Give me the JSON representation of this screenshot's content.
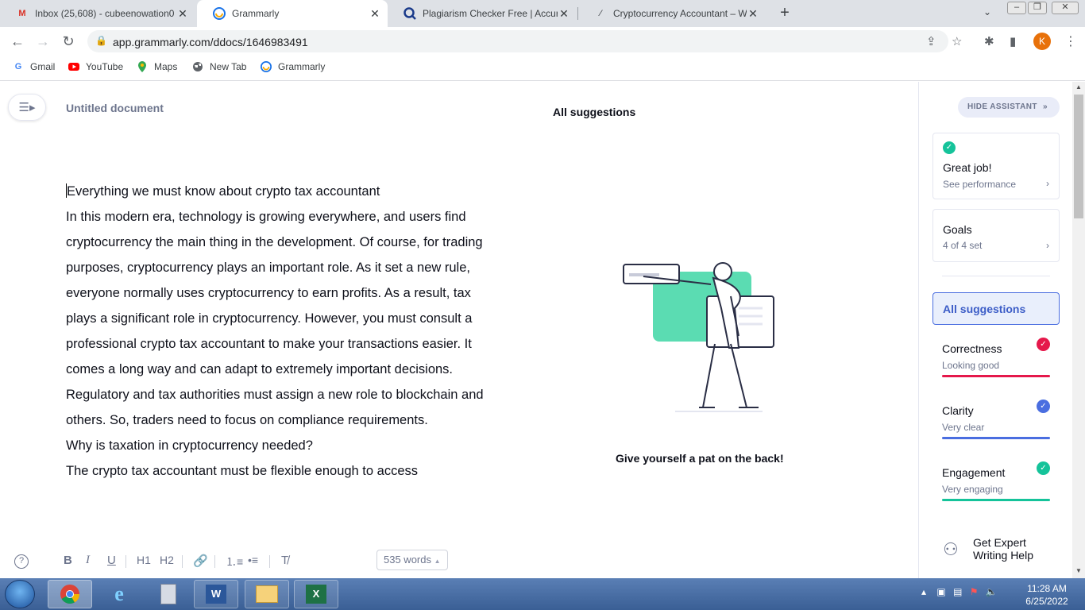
{
  "browser": {
    "tabs": [
      {
        "title": "Inbox (25,608) - cubeenowation0",
        "icon": "gmail-icon"
      },
      {
        "title": "Grammarly",
        "icon": "grammarly-icon",
        "active": true
      },
      {
        "title": "Plagiarism Checker Free | Accurat",
        "icon": "plagiarism-icon"
      },
      {
        "title": "Cryptocurrency Accountant – Wh",
        "icon": "docs-icon"
      }
    ],
    "new_tab": "+",
    "url": "app.grammarly.com/ddocs/1646983491",
    "profile_initial": "K",
    "bookmarks": [
      {
        "label": "Gmail",
        "icon": "google-icon"
      },
      {
        "label": "YouTube",
        "icon": "youtube-icon"
      },
      {
        "label": "Maps",
        "icon": "maps-icon"
      },
      {
        "label": "New Tab",
        "icon": "globe-icon"
      },
      {
        "label": "Grammarly",
        "icon": "grammarly-icon"
      }
    ]
  },
  "editor": {
    "doc_title": "Untitled document",
    "center_heading": "All suggestions",
    "illustration_caption": "Give yourself a pat on the back!",
    "paragraphs": [
      "Everything we must know about crypto tax accountant",
      "In this modern era, technology is growing everywhere, and users find cryptocurrency the main thing in the development. Of course, for trading purposes, cryptocurrency plays an important role. As it set a new rule, everyone normally uses cryptocurrency to earn profits. As a result, tax plays a significant role in cryptocurrency. However, you must consult a professional crypto tax accountant to make your transactions easier. It comes a long way and can adapt to extremely important decisions. Regulatory and tax authorities must assign a new role to blockchain and others. So, traders need to focus on compliance requirements.",
      "Why is taxation in cryptocurrency needed?",
      "The crypto tax accountant must be flexible enough to access"
    ],
    "toolbar": {
      "bold": "B",
      "italic": "I",
      "underline": "U",
      "h1": "H1",
      "h2": "H2",
      "word_count": "535 words"
    }
  },
  "assistant": {
    "hide_label": "HIDE ASSISTANT",
    "performance": {
      "title": "Great job!",
      "sub": "See performance"
    },
    "goals": {
      "title": "Goals",
      "sub": "4 of 4 set"
    },
    "all_suggestions": "All suggestions",
    "categories": [
      {
        "name": "Correctness",
        "status": "Looking good",
        "color": "#e5184b"
      },
      {
        "name": "Clarity",
        "status": "Very clear",
        "color": "#4a6ee0"
      },
      {
        "name": "Engagement",
        "status": "Very engaging",
        "color": "#15c39a"
      }
    ],
    "expert": "Get Expert Writing Help"
  },
  "taskbar": {
    "apps": [
      "chrome-icon",
      "ie-icon",
      "calculator-icon",
      "word-icon",
      "explorer-icon",
      "excel-icon"
    ],
    "time": "11:28 AM",
    "date": "6/25/2022"
  }
}
